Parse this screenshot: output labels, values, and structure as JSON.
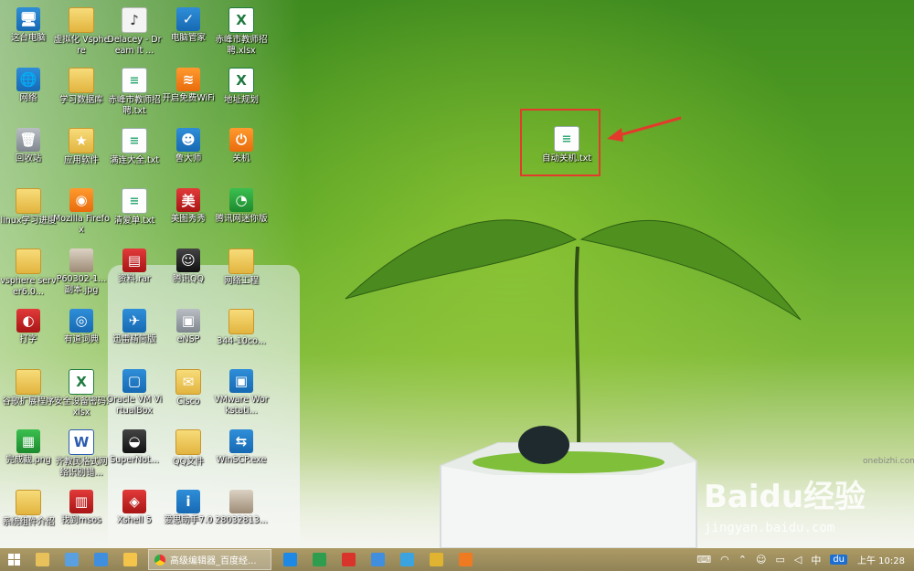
{
  "desktop": {
    "icons": [
      {
        "label": "这台电脑",
        "glyph": "🖥",
        "cls": "app-blue"
      },
      {
        "label": "虚拟化 Vsphere",
        "glyph": "",
        "cls": "folder"
      },
      {
        "label": "Delacey - Dream It ...",
        "glyph": "♪",
        "cls": "app-white"
      },
      {
        "label": "电脑管家",
        "glyph": "✓",
        "cls": "app-blue"
      },
      {
        "label": "赤峰市教师招聘.xlsx",
        "glyph": "X",
        "cls": "excel"
      },
      {
        "label": "网络",
        "glyph": "🌐",
        "cls": "app-blue"
      },
      {
        "label": "学习数据库",
        "glyph": "",
        "cls": "folder"
      },
      {
        "label": "赤峰市教师招聘.txt",
        "glyph": "≡",
        "cls": "txt"
      },
      {
        "label": "开启免费WiFi",
        "glyph": "≋",
        "cls": "app-orange"
      },
      {
        "label": "地址规划",
        "glyph": "X",
        "cls": "excel"
      },
      {
        "label": "回收站",
        "glyph": "🗑",
        "cls": "app-gray"
      },
      {
        "label": "应用软件",
        "glyph": "★",
        "cls": "folder"
      },
      {
        "label": "满连大全.txt",
        "glyph": "≡",
        "cls": "txt"
      },
      {
        "label": "鲁大师",
        "glyph": "☻",
        "cls": "app-blue"
      },
      {
        "label": "关机",
        "glyph": "⏻",
        "cls": "app-orange"
      },
      {
        "label": "linux学习进度",
        "glyph": "",
        "cls": "folder"
      },
      {
        "label": "Mozilla Firefox",
        "glyph": "◉",
        "cls": "app-orange"
      },
      {
        "label": "清爱单.txt",
        "glyph": "≡",
        "cls": "txt"
      },
      {
        "label": "美图秀秀",
        "glyph": "美",
        "cls": "app-red"
      },
      {
        "label": "腾讯网迷你版",
        "glyph": "◔",
        "cls": "app-green"
      },
      {
        "label": "vsphere server6.0...",
        "glyph": "",
        "cls": "folder"
      },
      {
        "label": "P60302-1...副本.jpg",
        "glyph": "",
        "cls": "photo"
      },
      {
        "label": "资料.rar",
        "glyph": "▤",
        "cls": "app-red"
      },
      {
        "label": "腾讯QQ",
        "glyph": "☺",
        "cls": "app-dark"
      },
      {
        "label": "网络工程",
        "glyph": "",
        "cls": "folder"
      },
      {
        "label": "打字",
        "glyph": "◐",
        "cls": "app-red"
      },
      {
        "label": "有道词典",
        "glyph": "◎",
        "cls": "app-blue"
      },
      {
        "label": "迅雷精简版",
        "glyph": "✈",
        "cls": "app-blue"
      },
      {
        "label": "eNSP",
        "glyph": "▣",
        "cls": "app-gray"
      },
      {
        "label": "344-10co...",
        "glyph": "",
        "cls": "folder"
      },
      {
        "label": "谷歌扩展程序",
        "glyph": "",
        "cls": "folder"
      },
      {
        "label": "安全设备密码.xlsx",
        "glyph": "X",
        "cls": "excel"
      },
      {
        "label": "Oracle VM VirtualBox",
        "glyph": "▢",
        "cls": "app-blue"
      },
      {
        "label": "Cisco",
        "glyph": "✉",
        "cls": "folder"
      },
      {
        "label": "VMware Workstati...",
        "glyph": "▣",
        "cls": "app-blue"
      },
      {
        "label": "完成截.png",
        "glyph": "▦",
        "cls": "app-green"
      },
      {
        "label": "齐教民格式网络识别错...",
        "glyph": "W",
        "cls": "word"
      },
      {
        "label": "SuperNot...",
        "glyph": "◒",
        "cls": "app-dark"
      },
      {
        "label": "QQ文件",
        "glyph": "",
        "cls": "folder"
      },
      {
        "label": "WinSCP.exe",
        "glyph": "⇆",
        "cls": "app-blue"
      },
      {
        "label": "系统组件介绍",
        "glyph": "",
        "cls": "folder"
      },
      {
        "label": "找到msos",
        "glyph": "▥",
        "cls": "app-red"
      },
      {
        "label": "Xshell 5",
        "glyph": "◈",
        "cls": "app-red"
      },
      {
        "label": "爱思助手7.0",
        "glyph": "i",
        "cls": "app-blue"
      },
      {
        "label": "28032813...",
        "glyph": "",
        "cls": "photo"
      }
    ],
    "highlighted_file": {
      "label": "自动关机.txt",
      "glyph": "≡"
    }
  },
  "watermark": {
    "logo": "Baidu经验",
    "url": "jingyan.baidu.com",
    "corner": "onebizhi.com"
  },
  "taskbar": {
    "active_task": "高级编辑器_百度经...",
    "pinned": [
      {
        "name": "file-explorer",
        "color": "#e9c15a"
      },
      {
        "name": "calendar",
        "color": "#5aa0e0"
      },
      {
        "name": "store",
        "color": "#3f8fde"
      },
      {
        "name": "media",
        "color": "#f3c34a"
      }
    ],
    "pinned_after": [
      {
        "name": "teamviewer",
        "color": "#1e88e5"
      },
      {
        "name": "excel",
        "color": "#2e9e4e"
      },
      {
        "name": "xshell",
        "color": "#d9342b"
      },
      {
        "name": "baidu-netdisk",
        "color": "#3f8fde"
      },
      {
        "name": "computer",
        "color": "#3aa3e0"
      },
      {
        "name": "chrome-alt",
        "color": "#e0b430"
      },
      {
        "name": "firefox",
        "color": "#ee7a22"
      }
    ],
    "tray": {
      "ime": "中",
      "du": "du",
      "clock": "上午 10:28"
    }
  }
}
